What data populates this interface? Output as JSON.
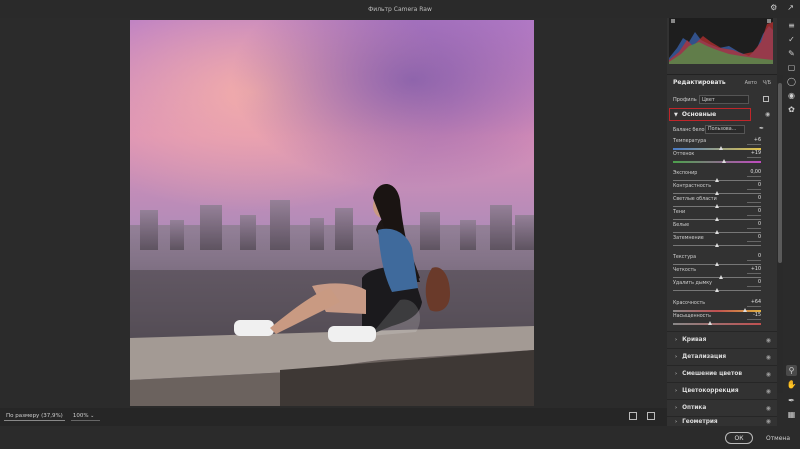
{
  "window": {
    "title": "Фильтр Camera Raw"
  },
  "bottom_bar": {
    "zoom_mode": "По размеру (37,9%)",
    "zoom_percent": "100%"
  },
  "footer": {
    "ok_label": "ОК",
    "cancel_label": "Отмена"
  },
  "panel": {
    "edit_title": "Редактировать",
    "auto_label": "Авто",
    "bw_label": "Ч/Б",
    "profile_label": "Профиль",
    "profile_value": "Цвет",
    "basic_section": "Основные",
    "wb_label": "Баланс белого",
    "wb_value": "Пользова...",
    "sliders": [
      {
        "label": "Температура",
        "value": "+6",
        "position": 0.54
      },
      {
        "label": "Оттенок",
        "value": "+19",
        "position": 0.58
      },
      {
        "label": "Экспонир",
        "value": "0,00",
        "position": 0.5
      },
      {
        "label": "Контрастность",
        "value": "0",
        "position": 0.5
      },
      {
        "label": "Светлые области",
        "value": "0",
        "position": 0.5
      },
      {
        "label": "Тени",
        "value": "0",
        "position": 0.5
      },
      {
        "label": "Белые",
        "value": "0",
        "position": 0.5
      },
      {
        "label": "Затемнение",
        "value": "0",
        "position": 0.5
      },
      {
        "label": "Текстура",
        "value": "0",
        "position": 0.5
      },
      {
        "label": "Четкость",
        "value": "+10",
        "position": 0.55
      },
      {
        "label": "Удалить дымку",
        "value": "0",
        "position": 0.5
      },
      {
        "label": "Красочность",
        "value": "+64",
        "position": 0.82
      },
      {
        "label": "Насыщенность",
        "value": "-15",
        "position": 0.42
      }
    ],
    "collapsed_sections": [
      "Кривая",
      "Детализация",
      "Смешение цветов",
      "Цветокоррекция",
      "Оптика",
      "Геометрия"
    ]
  },
  "toolbar_icons": [
    "gear-icon",
    "expand-icon",
    "sliders-icon",
    "healing-icon",
    "brush-icon",
    "mask-icon",
    "redeye-icon",
    "presets-icon",
    "zoom-icon",
    "hand-icon",
    "eyedropper-icon",
    "grid-icon"
  ],
  "colors": {
    "accent_red": "#c0262a",
    "panel_bg": "#323232",
    "app_bg": "#2b2b2b"
  }
}
